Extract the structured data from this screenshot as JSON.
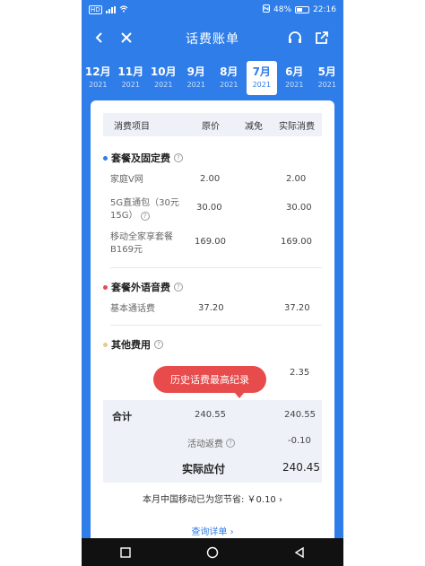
{
  "status": {
    "left": "HD",
    "battery": "48%",
    "time": "22:16"
  },
  "nav": {
    "title": "话费账单"
  },
  "months": [
    {
      "month": "12月",
      "year": "2021"
    },
    {
      "month": "11月",
      "year": "2021"
    },
    {
      "month": "10月",
      "year": "2021"
    },
    {
      "month": "9月",
      "year": "2021"
    },
    {
      "month": "8月",
      "year": "2021"
    },
    {
      "month": "7月",
      "year": "2021"
    },
    {
      "month": "6月",
      "year": "2021"
    },
    {
      "month": "5月",
      "year": "2021"
    }
  ],
  "active_month_index": 5,
  "table": {
    "headers": [
      "消费项目",
      "原价",
      "减免",
      "实际消费"
    ]
  },
  "sections": {
    "package": {
      "title": "套餐及固定费",
      "dot_color": "#2f7de9",
      "rows": [
        {
          "label": "家庭V网",
          "original": "2.00",
          "actual": "2.00"
        },
        {
          "label": "5G直通包（30元15G）",
          "original": "30.00",
          "actual": "30.00"
        },
        {
          "label": "移动全家享套餐B169元",
          "original": "169.00",
          "actual": "169.00"
        }
      ]
    },
    "voice": {
      "title": "套餐外语音费",
      "dot_color": "#e84b4b",
      "rows": [
        {
          "label": "基本通话费",
          "original": "37.20",
          "actual": "37.20"
        }
      ]
    },
    "other": {
      "title": "其他费用",
      "dot_color": "#e8c98a",
      "rows": [
        {
          "label": "",
          "original": "",
          "actual": "2.35"
        }
      ]
    }
  },
  "bubble": {
    "text": "历史话费最高纪录"
  },
  "summary": {
    "total_label": "合计",
    "total_original": "240.55",
    "total_actual": "240.55",
    "refund_label": "活动返费",
    "refund_value": "-0.10",
    "payable_label": "实际应付",
    "payable_value": "240.45"
  },
  "savings": {
    "text": "本月中国移动已为您节省: ￥0.10",
    "chevron": "›"
  },
  "detail": {
    "text": "查询详单",
    "chevron": "›"
  }
}
